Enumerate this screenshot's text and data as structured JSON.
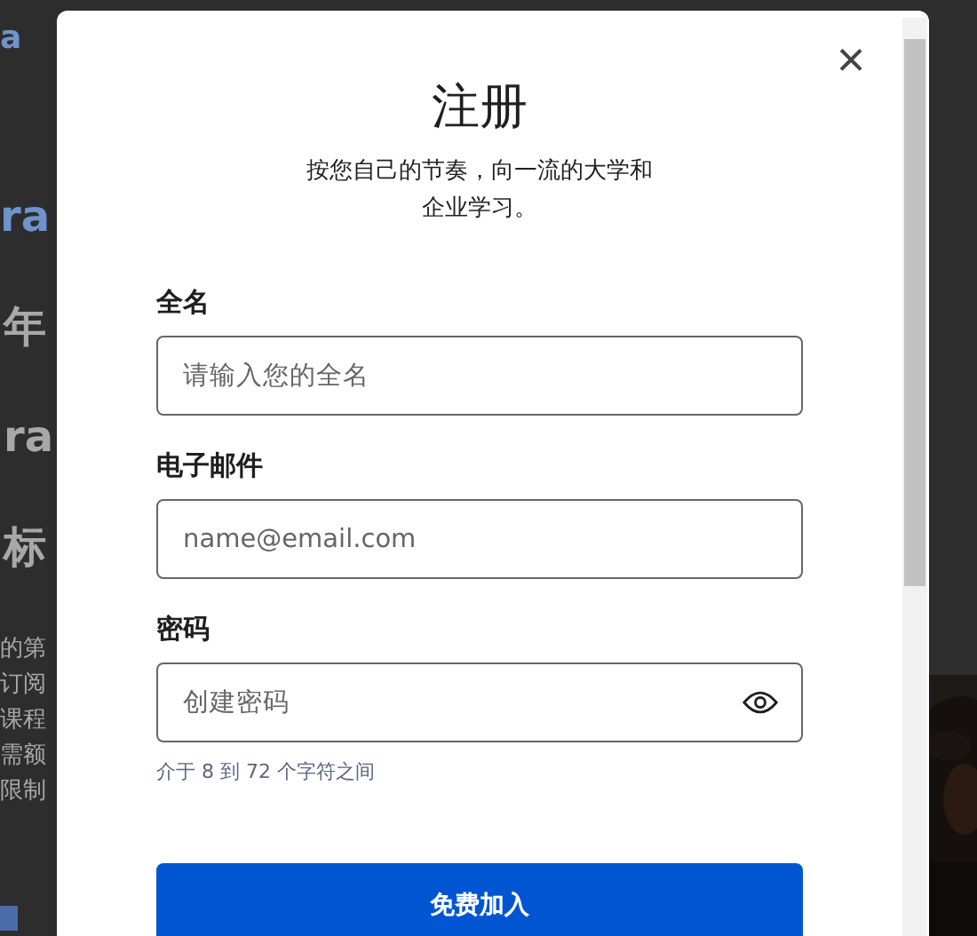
{
  "background_page": {
    "left_fragments": [
      {
        "kind": "logo",
        "text": "a"
      },
      {
        "kind": "brand",
        "text": "ra"
      },
      {
        "kind": "heading",
        "text": "年"
      },
      {
        "kind": "heading",
        "text": "ra"
      },
      {
        "kind": "heading",
        "text": "标"
      },
      {
        "kind": "line",
        "text": "的第"
      },
      {
        "kind": "line",
        "text": "订阅"
      },
      {
        "kind": "line",
        "text": "课程"
      },
      {
        "kind": "line",
        "text": "需额"
      },
      {
        "kind": "line",
        "text": "限制"
      }
    ]
  },
  "modal": {
    "close": "×",
    "title": "注册",
    "subtitle": "按您自己的节奏，向一流的大学和企业学习。",
    "fields": [
      {
        "label": "全名",
        "placeholder": "请输入您的全名",
        "kind": "text"
      },
      {
        "label": "电子邮件",
        "placeholder": "name@email.com",
        "kind": "text"
      },
      {
        "label": "密码",
        "placeholder": "创建密码",
        "kind": "password",
        "hint": "介于 8 到 72 个字符之间"
      }
    ],
    "submit": "免费加入"
  }
}
